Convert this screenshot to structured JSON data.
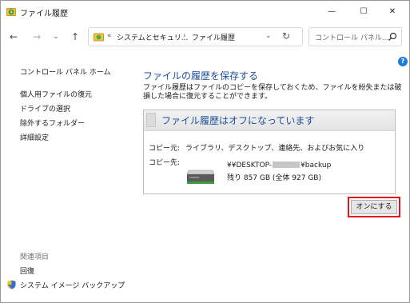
{
  "window": {
    "title": "ファイル履歴",
    "minimize_glyph": "—",
    "maximize_glyph": "☐",
    "close_glyph": "✕"
  },
  "nav": {
    "back_glyph": "←",
    "forward_glyph": "→",
    "recent_glyph": "⌄",
    "up_glyph": "↑",
    "address": {
      "overflow": "«",
      "crumbs": [
        "システムとセキュリ...",
        "ファイル履歴"
      ],
      "separator": "›",
      "dropdown_glyph": "⌄",
      "refresh_glyph": "↻"
    },
    "search": {
      "placeholder": "コントロール パネル..."
    }
  },
  "left_pane": {
    "home_link": "コントロール パネル ホーム",
    "links": [
      "個人用ファイルの復元",
      "ドライブの選択",
      "除外するフォルダー",
      "詳細設定"
    ],
    "see_also_heading": "関連項目",
    "see_also_links": [
      "回復",
      "システム イメージ バックアップ"
    ]
  },
  "main": {
    "help_glyph": "?",
    "title": "ファイルの履歴を保存する",
    "description": "ファイル履歴はファイルのコピーを保存しておくため、ファイルを紛失または破損した場合に復元することができます。",
    "status": {
      "heading": "ファイル履歴はオフになっています",
      "copy_from_label": "コピー元:",
      "copy_from_value": "ライブラリ、デスクトップ、連絡先、およびお気に入り",
      "copy_to_label": "コピー先:",
      "drive_path_prefix": "¥¥DESKTOP-",
      "drive_path_suffix": "¥backup",
      "drive_space": "残り 857 GB (全体 927 GB)"
    },
    "turn_on_button": "オンにする"
  },
  "colors": {
    "accent_title": "#1e4f9a",
    "highlight_outline": "#e0141e",
    "help_icon": "#1f7bd8"
  },
  "icons": {
    "app": "file-history-icon",
    "drive": "external-drive-icon",
    "shield": "uac-shield-icon",
    "search": "search-icon"
  }
}
